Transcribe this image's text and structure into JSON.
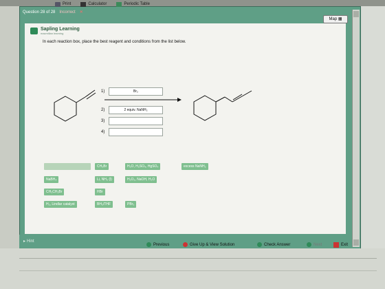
{
  "toolbar": {
    "print_label": "Print",
    "calculator_label": "Calculator",
    "periodic_table_label": "Periodic Table"
  },
  "question_bar": {
    "question_label": "Question 28 of 28",
    "status_label": "Incorrect"
  },
  "map_button": "Map",
  "logo": {
    "name": "Sapling Learning",
    "tagline": "macmillan learning"
  },
  "instructions": "In each reaction box, place the best reagent and conditions from the list below.",
  "steps": {
    "s1": "1)",
    "s2": "2)",
    "s3": "3)",
    "s4": "4)",
    "box1": "Br₂",
    "box2": "2 equiv. NaNH₂",
    "box3": "",
    "box4": ""
  },
  "reagents": {
    "r_ch3br": "CH₃Br",
    "r_hg": "H₂O, H₂SO₄, HgSO₄",
    "r_excess": "excess NaNH₂",
    "r_nabh4": "NaBH₄",
    "r_li": "Li, NH₃ (l)",
    "r_h2o2": "H₂O₂, NaOH, H₂O",
    "r_ch3ch2br": "CH₃CH₂Br",
    "r_hbr": "HBr",
    "r_lindlar": "H₂, Lindlar catalyst",
    "r_bh3": "BH₃/THF",
    "r_pbr3": "PBr₃"
  },
  "bottom": {
    "hint": "Hint",
    "previous": "Previous",
    "give_up": "Give Up & View Solution",
    "check": "Check Answer",
    "next": "Next",
    "exit": "Exit"
  },
  "colors": {
    "frame_green": "#5f9f86",
    "tile_green": "#7fbf8f",
    "incorrect_red": "#cc3333"
  }
}
